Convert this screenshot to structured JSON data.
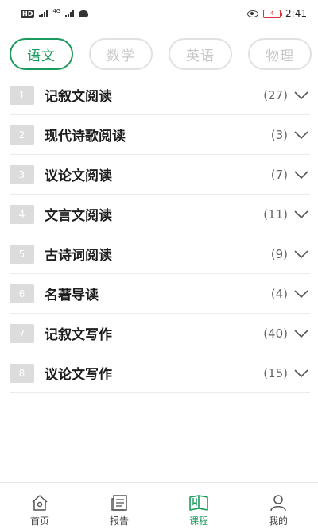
{
  "status_bar": {
    "badge": "HD",
    "network": "4G",
    "battery": "4",
    "time": "2:41"
  },
  "tabs": [
    {
      "label": "语文",
      "active": true
    },
    {
      "label": "数学",
      "active": false
    },
    {
      "label": "英语",
      "active": false
    },
    {
      "label": "物理",
      "active": false
    }
  ],
  "list": [
    {
      "index": "1",
      "title": "记叙文阅读",
      "count": "(27)"
    },
    {
      "index": "2",
      "title": "现代诗歌阅读",
      "count": "(3)"
    },
    {
      "index": "3",
      "title": "议论文阅读",
      "count": "(7)"
    },
    {
      "index": "4",
      "title": "文言文阅读",
      "count": "(11)"
    },
    {
      "index": "5",
      "title": "古诗词阅读",
      "count": "(9)"
    },
    {
      "index": "6",
      "title": "名著导读",
      "count": "(4)"
    },
    {
      "index": "7",
      "title": "记叙文写作",
      "count": "(40)"
    },
    {
      "index": "8",
      "title": "议论文写作",
      "count": "(15)"
    }
  ],
  "bottom_nav": [
    {
      "label": "首页",
      "icon": "home-icon",
      "active": false
    },
    {
      "label": "报告",
      "icon": "report-icon",
      "active": false
    },
    {
      "label": "课程",
      "icon": "course-book-icon",
      "active": true
    },
    {
      "label": "我的",
      "icon": "profile-icon",
      "active": false
    }
  ],
  "colors": {
    "accent": "#1a9b5e",
    "inactive_tab": "#c8c8c8",
    "index_badge": "#dcdcdc"
  }
}
